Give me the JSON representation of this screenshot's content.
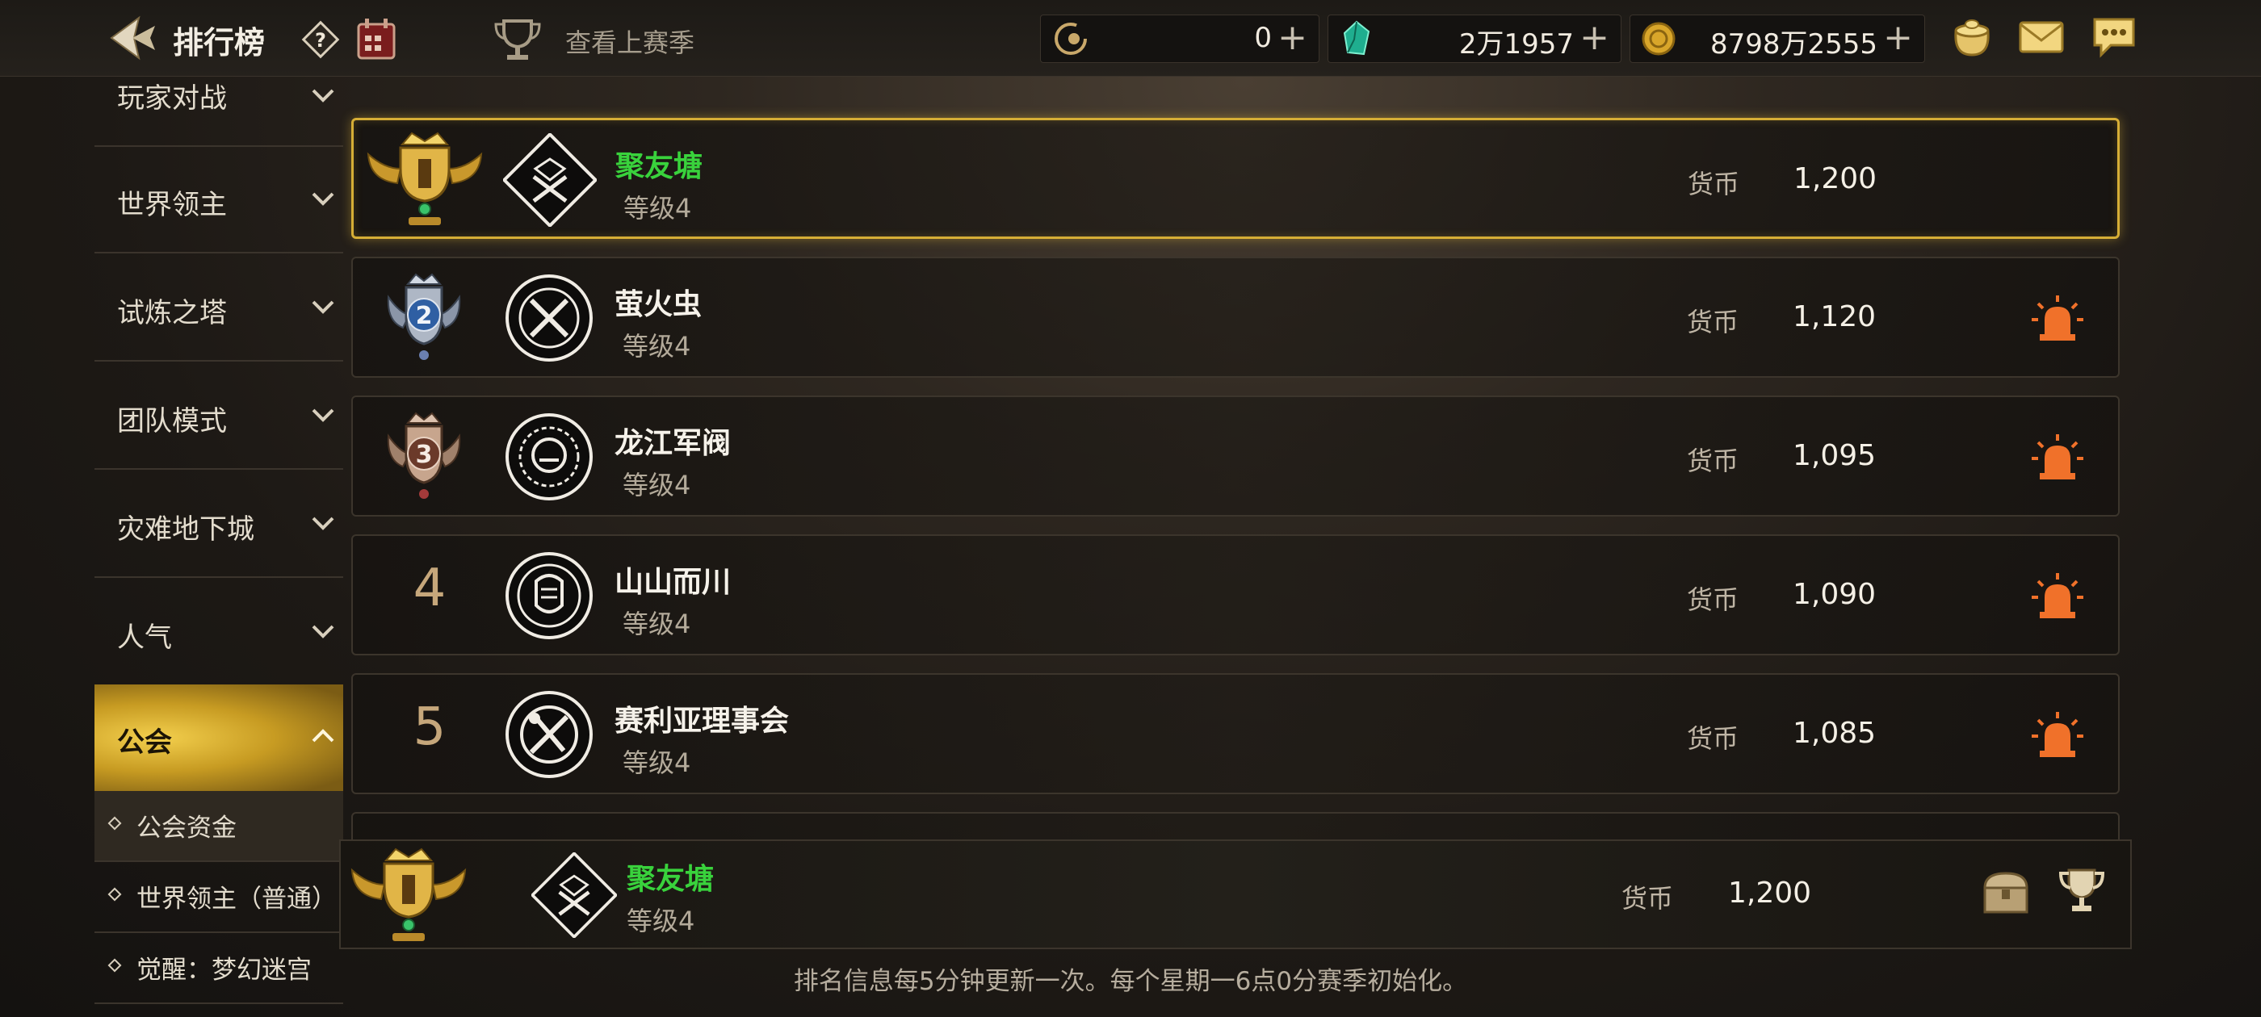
{
  "header": {
    "title": "排行榜",
    "prev_season": "查看上赛季",
    "currencies": [
      {
        "icon": "crescent-coin-icon",
        "amount": "0"
      },
      {
        "icon": "green-gem-icon",
        "amount": "2万1957"
      },
      {
        "icon": "gold-coin-icon",
        "amount": "8798万2555"
      }
    ],
    "icons": [
      "back-arrow-icon",
      "help-icon",
      "calendar-icon",
      "trophy-icon",
      "pouch-icon",
      "mail-icon",
      "chat-icon"
    ]
  },
  "sidebar": {
    "items": [
      {
        "label": "玩家对战"
      },
      {
        "label": "世界领主"
      },
      {
        "label": "试炼之塔"
      },
      {
        "label": "团队模式"
      },
      {
        "label": "灾难地下城"
      },
      {
        "label": "人气"
      },
      {
        "label": "公会"
      }
    ],
    "sub_items": [
      {
        "label": "公会资金"
      },
      {
        "label": "世界领主（普通）"
      },
      {
        "label": "觉醒：梦幻迷宫"
      }
    ]
  },
  "rankings": [
    {
      "rank": "1",
      "name": "聚友塘",
      "level": "等级4",
      "currency_label": "货币",
      "value": "1,200"
    },
    {
      "rank": "2",
      "name": "萤火虫",
      "level": "等级4",
      "currency_label": "货币",
      "value": "1,120"
    },
    {
      "rank": "3",
      "name": "龙江军阀",
      "level": "等级4",
      "currency_label": "货币",
      "value": "1,095"
    },
    {
      "rank": "4",
      "name": "山山而川",
      "level": "等级4",
      "currency_label": "货币",
      "value": "1,090"
    },
    {
      "rank": "5",
      "name": "赛利亚理事会",
      "level": "等级4",
      "currency_label": "货币",
      "value": "1,085"
    }
  ],
  "my_guild": {
    "rank": "1",
    "name": "聚友塘",
    "level": "等级4",
    "currency_label": "货币",
    "value": "1,200"
  },
  "footer_note": "排名信息每5分钟更新一次。每个星期一6点0分赛季初始化。",
  "colors": {
    "accent_gold": "#d6ae36",
    "my_guild_green": "#39d23c",
    "alert_orange": "#f0712a"
  }
}
